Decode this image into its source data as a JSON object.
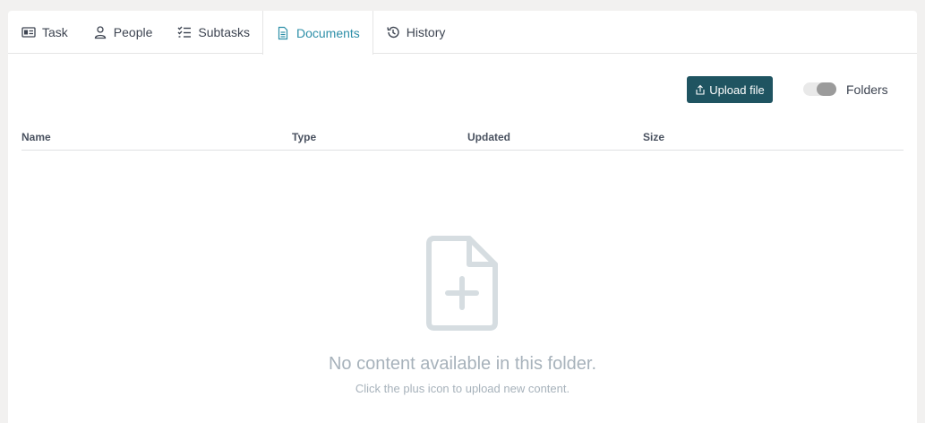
{
  "tabs": [
    {
      "label": "Task",
      "icon": "id-card-icon"
    },
    {
      "label": "People",
      "icon": "person-icon"
    },
    {
      "label": "Subtasks",
      "icon": "checklist-icon"
    },
    {
      "label": "Documents",
      "icon": "document-icon",
      "active": true
    },
    {
      "label": "History",
      "icon": "history-icon"
    }
  ],
  "toolbar": {
    "upload_label": "Upload file",
    "folders_label": "Folders",
    "folders_toggle_on": false
  },
  "table": {
    "columns": [
      "Name",
      "Type",
      "Updated",
      "Size"
    ],
    "rows": []
  },
  "empty_state": {
    "icon": "file-add-icon",
    "title": "No content available in this folder.",
    "subtitle": "Click the plus icon to upload new content."
  },
  "colors": {
    "accent": "#2d8fa8",
    "button": "#1f5461",
    "empty_text": "#a7b2bb"
  }
}
